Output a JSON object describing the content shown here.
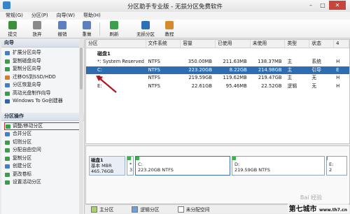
{
  "window": {
    "title": "分区助手专业版 - 无损分区免费软件",
    "min": "–",
    "max": "□",
    "close": "✕"
  },
  "menu": [
    "常规(G)",
    "分区(P)",
    "向导(W)",
    "帮助(H)"
  ],
  "toolbar": [
    {
      "label": "提交",
      "icon": "commit-icon",
      "color": "#3c8f3c"
    },
    {
      "label": "放弃",
      "icon": "discard-icon",
      "color": "#8a8a8a"
    },
    {
      "label": "撤销",
      "icon": "undo-icon",
      "color": "#5b7fbf"
    },
    {
      "label": "重做",
      "icon": "redo-icon",
      "color": "#5b7fbf"
    },
    {
      "label": "刷新",
      "icon": "refresh-icon",
      "color": "#3aa14a"
    },
    {
      "label": "无损分区",
      "icon": "lossless-partition-icon",
      "color": "#2d6fb8"
    },
    {
      "label": "教程",
      "icon": "tutorial-icon",
      "color": "#d88a2a"
    }
  ],
  "sidebar": {
    "wizard_header": "向导",
    "wizard_items": [
      {
        "label": "扩展分区向导",
        "color": "#3f7fd0"
      },
      {
        "label": "复制磁盘向导",
        "color": "#3a9d4a"
      },
      {
        "label": "复制分区向导",
        "color": "#3a9d4a"
      },
      {
        "label": "迁移OS到SSD/HDD",
        "color": "#d97b27"
      },
      {
        "label": "分区恢复向导",
        "color": "#3f7fd0"
      },
      {
        "label": "高动光盘制作向导",
        "color": "#3a9d4a"
      },
      {
        "label": "Windows To Go创建器",
        "color": "#2b66b5"
      }
    ],
    "ops_header": "分区操作",
    "ops_items": [
      {
        "label": "调整/移动分区",
        "color": "#3a9d4a",
        "highlight": true
      },
      {
        "label": "合并分区",
        "color": "#3f7fd0"
      },
      {
        "label": "切割分区",
        "color": "#3a9d4a"
      },
      {
        "label": "分配自由空间",
        "color": "#3a9d4a"
      },
      {
        "label": "复制分区",
        "color": "#3a9d4a"
      },
      {
        "label": "创建分区",
        "color": "#3f7fd0"
      },
      {
        "label": "更改卷标",
        "color": "#3a9d4a"
      },
      {
        "label": "设置活动分区",
        "color": "#3a9d4a"
      }
    ]
  },
  "table": {
    "headers": [
      "分区",
      "文件系统",
      "容量",
      "已使用",
      "未使用",
      "类型",
      "状态",
      "4"
    ],
    "disk_title": "磁盘1",
    "rows": [
      {
        "name": "*: System Reserved",
        "fs": "NTFS",
        "cap": "350.00MB",
        "used": "211.63MB",
        "free": "138.37MB",
        "type": "主",
        "status": "系统",
        "extra": "H",
        "selected": false
      },
      {
        "name": "C:",
        "fs": "NTFS",
        "cap": "223.20GB",
        "used": "8.22GB",
        "free": "214.98GB",
        "type": "主",
        "status": "引导",
        "extra": "E",
        "selected": true
      },
      {
        "name": "D:",
        "fs": "NTFS",
        "cap": "219.59GB",
        "used": "119.62MB",
        "free": "219.47GB",
        "type": "主",
        "status": "无",
        "extra": "H",
        "selected": false
      },
      {
        "name": "E:",
        "fs": "NTFS",
        "cap": "22.61GB",
        "used": "95.46MB",
        "free": "22.52GB",
        "type": "逻辑",
        "status": "无",
        "extra": "H",
        "selected": false
      }
    ]
  },
  "diskmap": {
    "disk_name": "磁盘1",
    "disk_type": "基本 MBR",
    "disk_size": "465.76GB",
    "partitions": [
      {
        "letter": "*",
        "info": "3",
        "used_frac": 0.6,
        "selected": false
      },
      {
        "letter": "C:",
        "info": "223.20GB NTFS",
        "used_frac": 0.04,
        "selected": true
      },
      {
        "letter": "D:",
        "info": "219.59GB NTFS",
        "used_frac": 0.01,
        "selected": false
      },
      {
        "letter": "E:",
        "info": "2",
        "used_frac": 0.01,
        "selected": false
      }
    ]
  },
  "legend": [
    {
      "label": "主分区",
      "color": "#a7d36a"
    },
    {
      "label": "逻辑分区",
      "color": "#6ba1de"
    },
    {
      "label": "未分配空间",
      "color": "#ffffff"
    }
  ],
  "watermark": {
    "site": "第七城市",
    "url": "www.th7.cn",
    "jingyan": "Bai 经验"
  }
}
